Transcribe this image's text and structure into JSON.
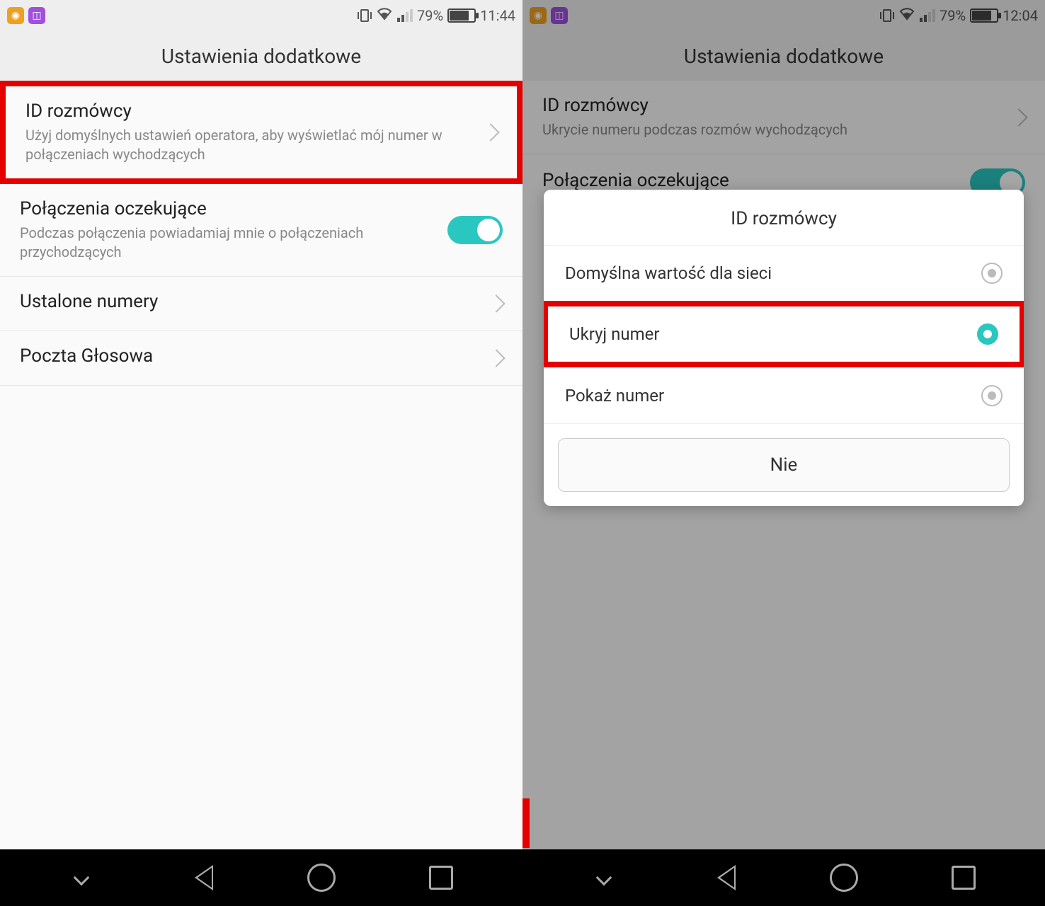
{
  "left": {
    "status": {
      "battery_pct": "79%",
      "time": "11:44"
    },
    "header": "Ustawienia dodatkowe",
    "caller_id": {
      "title": "ID rozmówcy",
      "sub": "Użyj domyślnych ustawień operatora, aby wyświetlać mój numer w połączeniach wychodzących"
    },
    "call_waiting": {
      "title": "Połączenia oczekujące",
      "sub": "Podczas połączenia powiadamiaj mnie o połączeniach przychodzących"
    },
    "fixed_numbers": "Ustalone numery",
    "voicemail": "Poczta Głosowa"
  },
  "right": {
    "status": {
      "battery_pct": "79%",
      "time": "12:04"
    },
    "header": "Ustawienia dodatkowe",
    "caller_id": {
      "title": "ID rozmówcy",
      "sub": "Ukrycie numeru podczas rozmów wychodzących"
    },
    "call_waiting_title": "Połączenia oczekujące",
    "dialog": {
      "title": "ID rozmówcy",
      "opt_default": "Domyślna wartość dla sieci",
      "opt_hide": "Ukryj numer",
      "opt_show": "Pokaż numer",
      "cancel": "Nie"
    }
  }
}
